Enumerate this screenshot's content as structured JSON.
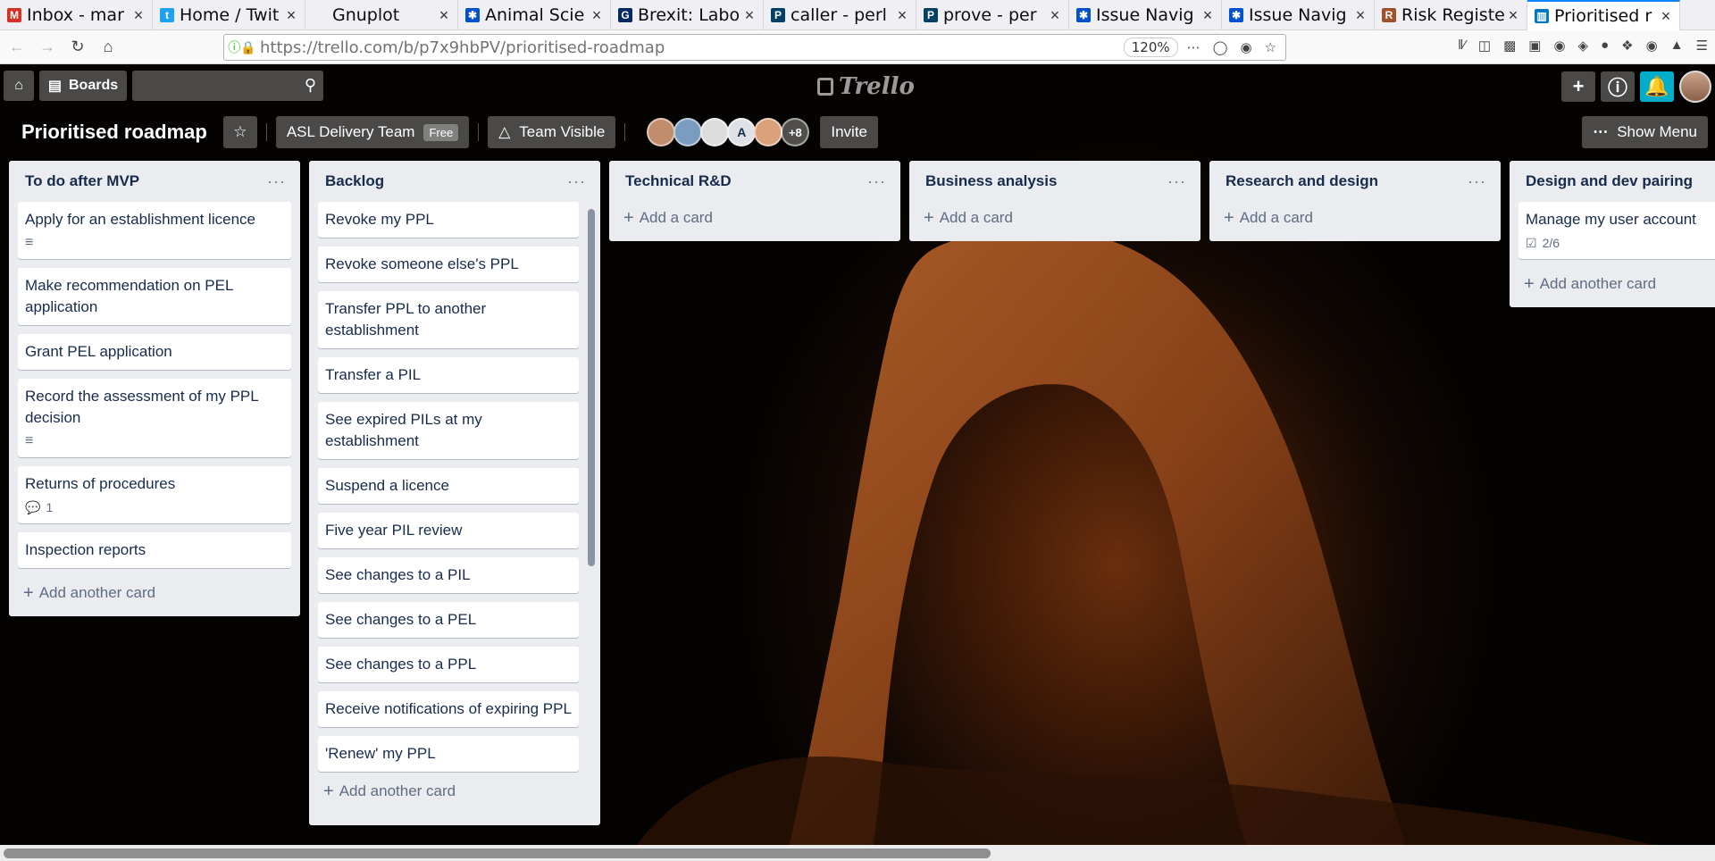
{
  "browser": {
    "tabs": [
      {
        "title": "Inbox - mar",
        "icon": "gmail-icon",
        "color": "#d93025",
        "glyph": "M"
      },
      {
        "title": "Home / Twit",
        "icon": "twitter-icon",
        "color": "#1da1f2",
        "glyph": "t"
      },
      {
        "title": "Gnuplot",
        "icon": "blank-icon",
        "color": "#f0f0f4",
        "glyph": ""
      },
      {
        "title": "Animal Scie",
        "icon": "jira-icon",
        "color": "#0052cc",
        "glyph": "✱"
      },
      {
        "title": "Brexit: Labo",
        "icon": "guardian-icon",
        "color": "#052962",
        "glyph": "G"
      },
      {
        "title": "caller - perl",
        "icon": "perl-icon",
        "color": "#004065",
        "glyph": "P"
      },
      {
        "title": "prove - per",
        "icon": "perl-icon",
        "color": "#004065",
        "glyph": "P"
      },
      {
        "title": "Issue Navig",
        "icon": "jira-icon",
        "color": "#0052cc",
        "glyph": "✱"
      },
      {
        "title": "Issue Navig",
        "icon": "jira-icon",
        "color": "#0052cc",
        "glyph": "✱"
      },
      {
        "title": "Risk Registe",
        "icon": "sheet-icon",
        "color": "#a0522d",
        "glyph": "R"
      },
      {
        "title": "Prioritised r",
        "icon": "trello-icon",
        "color": "#0079bf",
        "glyph": "▥",
        "active": true
      }
    ],
    "url": "https://trello.com/b/p7x9hbPV/prioritised-roadmap",
    "zoom": "120%"
  },
  "header": {
    "boards_label": "Boards",
    "logo_text": "Trello"
  },
  "board": {
    "title": "Prioritised roadmap",
    "team_label": "ASL Delivery Team",
    "team_badge": "Free",
    "visibility_label": "Team Visible",
    "member_initial": "A",
    "more_members": "+8",
    "invite_label": "Invite",
    "show_menu_label": "Show Menu"
  },
  "lists": [
    {
      "title": "To do after MVP",
      "add_label": "Add another card",
      "cards": [
        {
          "text": "Apply for an establishment licence",
          "badges": {
            "description": true
          }
        },
        {
          "text": "Make recommendation on PEL application"
        },
        {
          "text": "Grant PEL application"
        },
        {
          "text": "Record the assessment of my PPL decision",
          "badges": {
            "description": true
          }
        },
        {
          "text": "Returns of procedures",
          "badges": {
            "comments": "1"
          }
        },
        {
          "text": "Inspection reports"
        }
      ]
    },
    {
      "title": "Backlog",
      "add_label": "Add another card",
      "cards": [
        {
          "text": "Revoke my PPL"
        },
        {
          "text": "Revoke someone else's PPL"
        },
        {
          "text": "Transfer PPL to another establishment"
        },
        {
          "text": "Transfer a PIL"
        },
        {
          "text": "See expired PILs at my establishment"
        },
        {
          "text": "Suspend a licence"
        },
        {
          "text": "Five year PIL review"
        },
        {
          "text": "See changes to a PIL"
        },
        {
          "text": "See changes to a PEL"
        },
        {
          "text": "See changes to a PPL"
        },
        {
          "text": "Receive notifications of expiring PPL"
        },
        {
          "text": "'Renew' my PPL"
        }
      ]
    },
    {
      "title": "Technical R&D",
      "add_label": "Add a card",
      "cards": []
    },
    {
      "title": "Business analysis",
      "add_label": "Add a card",
      "cards": []
    },
    {
      "title": "Research and design",
      "add_label": "Add a card",
      "cards": []
    },
    {
      "title": "Design and dev pairing",
      "add_label": "Add another card",
      "cards": [
        {
          "text": "Manage my user account",
          "badges": {
            "checklist": "2/6"
          }
        }
      ]
    }
  ],
  "colors": {
    "bell": "#00aecc",
    "list_bg": "#ebecf0"
  }
}
